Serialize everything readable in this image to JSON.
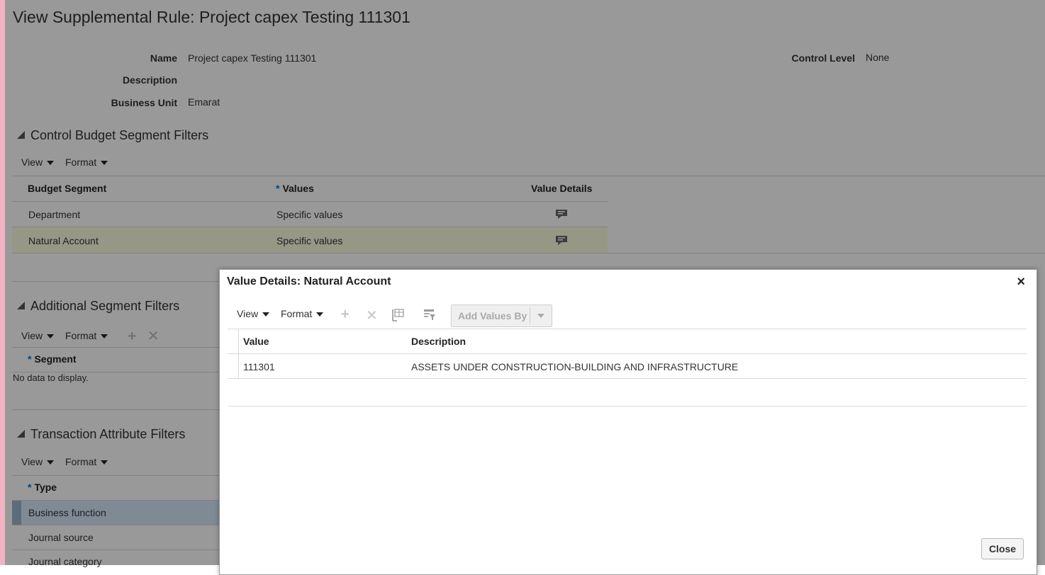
{
  "page": {
    "title": "View Supplemental Rule: Project capex Testing 111301",
    "fields": {
      "name_label": "Name",
      "name_value": "Project capex Testing 111301",
      "description_label": "Description",
      "business_unit_label": "Business Unit",
      "business_unit_value": "Emarat",
      "control_level_label": "Control Level",
      "control_level_value": "None"
    }
  },
  "toolbar": {
    "view": "View",
    "format": "Format"
  },
  "control_budget_section": {
    "title": "Control Budget Segment Filters",
    "columns": [
      "Budget Segment",
      "Values",
      "Value Details"
    ],
    "rows": [
      {
        "segment": "Department",
        "values": "Specific values"
      },
      {
        "segment": "Natural Account",
        "values": "Specific values"
      }
    ]
  },
  "additional_section": {
    "title": "Additional Segment Filters",
    "column": "Segment",
    "empty_text": "No data to display."
  },
  "transaction_section": {
    "title": "Transaction Attribute Filters",
    "column": "Type",
    "rows": [
      "Business function",
      "Journal source",
      "Journal category"
    ]
  },
  "dialog": {
    "title": "Value Details: Natural Account",
    "add_values_by": "Add Values By",
    "columns": [
      "Value",
      "Description"
    ],
    "rows": [
      {
        "value": "111301",
        "description": "ASSETS UNDER CONSTRUCTION-BUILDING AND INFRASTRUCTURE"
      }
    ],
    "close_label": "Close",
    "close_icon": "×"
  },
  "required_marker": "*",
  "icons": {
    "add": "+",
    "delete": "✕",
    "toggle": "triangle-down-right",
    "value_details": "details-icon"
  },
  "colors": {
    "required": "#0572ce",
    "row_highlight": "#fcfce0",
    "row_selected": "#d6e7f7"
  }
}
